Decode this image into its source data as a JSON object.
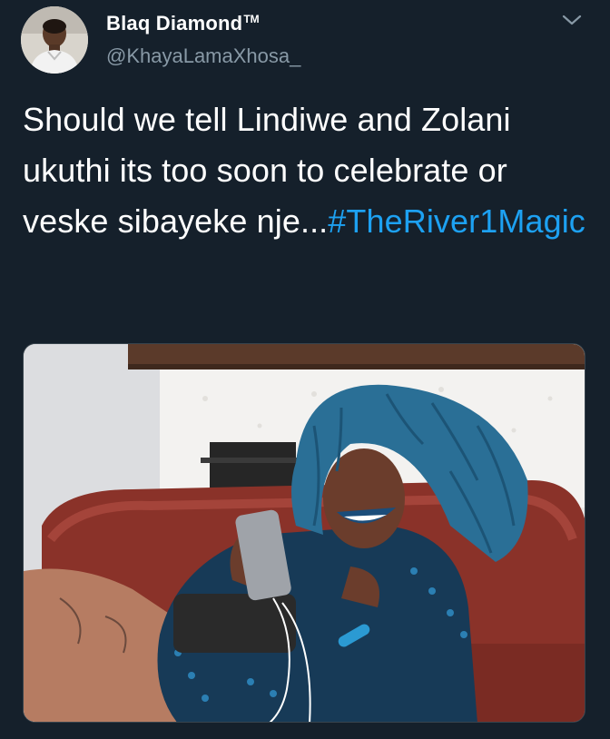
{
  "tweet": {
    "display_name": "Blaq Diamond",
    "trademark": "TM",
    "handle": "@KhayaLamaXhosa_",
    "text_main": "Should we tell Lindiwe and Zolani ukuthi its too soon to celebrate or veske sibayeke nje...",
    "hashtag": "#TheRiver1Magic",
    "caret_icon": "chevron-down-icon",
    "avatar_icon": "profile-avatar",
    "media_description_icon": "tweet-photo"
  },
  "colors": {
    "background": "#15202b",
    "text": "#ffffff",
    "secondary": "#8899a6",
    "link": "#1da1f2"
  }
}
